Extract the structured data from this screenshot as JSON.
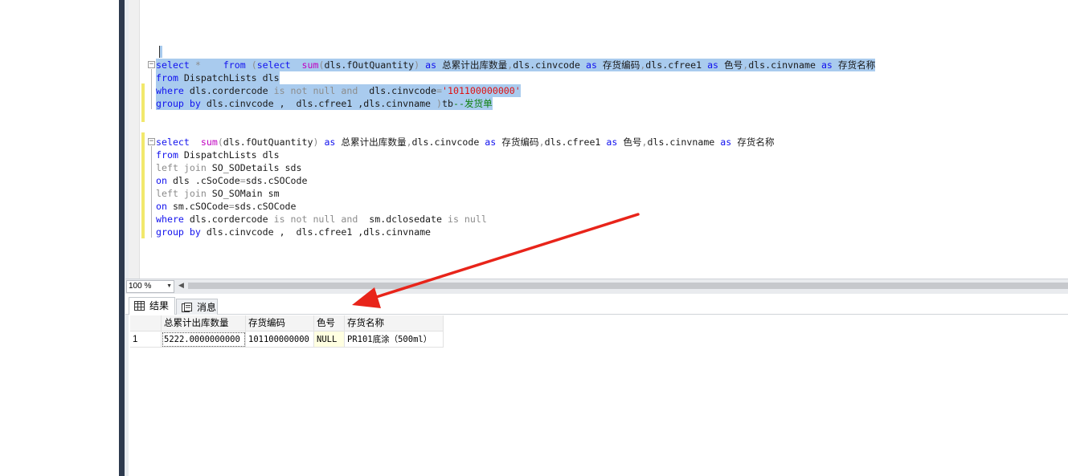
{
  "editor": {
    "query1": {
      "line1": [
        {
          "t": "select",
          "c": "kw"
        },
        {
          "t": " * ",
          "c": "gr"
        },
        {
          "t": "   ",
          "c": ""
        },
        {
          "t": "from",
          "c": "kw"
        },
        {
          "t": " (",
          "c": "gr"
        },
        {
          "t": "select",
          "c": "kw"
        },
        {
          "t": "  ",
          "c": ""
        },
        {
          "t": "sum",
          "c": "fn"
        },
        {
          "t": "(",
          "c": "gr"
        },
        {
          "t": "dls.fOutQuantity",
          "c": ""
        },
        {
          "t": ")",
          "c": "gr"
        },
        {
          "t": " ",
          "c": ""
        },
        {
          "t": "as",
          "c": "kw"
        },
        {
          "t": " 总累计出库数量",
          "c": ""
        },
        {
          "t": ",",
          "c": "gr"
        },
        {
          "t": "dls.cinvcode ",
          "c": ""
        },
        {
          "t": "as",
          "c": "kw"
        },
        {
          "t": " 存货编码",
          "c": ""
        },
        {
          "t": ",",
          "c": "gr"
        },
        {
          "t": "dls.cfree1 ",
          "c": ""
        },
        {
          "t": "as",
          "c": "kw"
        },
        {
          "t": " 色号",
          "c": ""
        },
        {
          "t": ",",
          "c": "gr"
        },
        {
          "t": "dls.cinvname ",
          "c": ""
        },
        {
          "t": "as",
          "c": "kw"
        },
        {
          "t": " 存货名称",
          "c": ""
        }
      ],
      "line2": [
        {
          "t": "from",
          "c": "kw"
        },
        {
          "t": " DispatchLists dls",
          "c": ""
        }
      ],
      "line3": [
        {
          "t": "where",
          "c": "kw"
        },
        {
          "t": " dls.cordercode ",
          "c": ""
        },
        {
          "t": "is not null and",
          "c": "gr"
        },
        {
          "t": "  dls.cinvcode",
          "c": ""
        },
        {
          "t": "=",
          "c": "gr"
        },
        {
          "t": "'101100000000'",
          "c": "str"
        }
      ],
      "line4": [
        {
          "t": "group by",
          "c": "kw"
        },
        {
          "t": " dls.cinvcode , ",
          "c": ""
        },
        {
          "t": " dls.cfree1 ,dls.cinvname ",
          "c": ""
        },
        {
          "t": ")",
          "c": "gr"
        },
        {
          "t": "tb",
          "c": ""
        },
        {
          "t": "--发货单",
          "c": "cm"
        }
      ]
    },
    "query2": [
      [
        {
          "t": "select",
          "c": "kw"
        },
        {
          "t": "  ",
          "c": ""
        },
        {
          "t": "sum",
          "c": "fn"
        },
        {
          "t": "(",
          "c": "gr"
        },
        {
          "t": "dls.fOutQuantity",
          "c": ""
        },
        {
          "t": ")",
          "c": "gr"
        },
        {
          "t": " ",
          "c": ""
        },
        {
          "t": "as",
          "c": "kw"
        },
        {
          "t": " 总累计出库数量",
          "c": ""
        },
        {
          "t": ",",
          "c": "gr"
        },
        {
          "t": "dls.cinvcode ",
          "c": ""
        },
        {
          "t": "as",
          "c": "kw"
        },
        {
          "t": " 存货编码",
          "c": ""
        },
        {
          "t": ",",
          "c": "gr"
        },
        {
          "t": "dls.cfree1 ",
          "c": ""
        },
        {
          "t": "as",
          "c": "kw"
        },
        {
          "t": " 色号",
          "c": ""
        },
        {
          "t": ",",
          "c": "gr"
        },
        {
          "t": "dls.cinvname ",
          "c": ""
        },
        {
          "t": "as",
          "c": "kw"
        },
        {
          "t": " 存货名称",
          "c": ""
        }
      ],
      [
        {
          "t": "from",
          "c": "kw"
        },
        {
          "t": " DispatchLists dls",
          "c": ""
        }
      ],
      [
        {
          "t": "left join",
          "c": "gr"
        },
        {
          "t": " SO_SODetails sds",
          "c": ""
        }
      ],
      [
        {
          "t": "on",
          "c": "kw"
        },
        {
          "t": " dls .cSoCode",
          "c": ""
        },
        {
          "t": "=",
          "c": "gr"
        },
        {
          "t": "sds.cSOCode",
          "c": ""
        }
      ],
      [
        {
          "t": "left join",
          "c": "gr"
        },
        {
          "t": " SO_SOMain sm",
          "c": ""
        }
      ],
      [
        {
          "t": "on",
          "c": "kw"
        },
        {
          "t": " sm.cSOCode",
          "c": ""
        },
        {
          "t": "=",
          "c": "gr"
        },
        {
          "t": "sds.cSOCode",
          "c": ""
        }
      ],
      [
        {
          "t": "where",
          "c": "kw"
        },
        {
          "t": " dls.cordercode ",
          "c": ""
        },
        {
          "t": "is not null and",
          "c": "gr"
        },
        {
          "t": "  sm.dclosedate ",
          "c": ""
        },
        {
          "t": "is null",
          "c": "gr"
        }
      ],
      [
        {
          "t": "group by",
          "c": "kw"
        },
        {
          "t": " dls.cinvcode , ",
          "c": ""
        },
        {
          "t": " dls.cfree1 ,dls.cinvname",
          "c": ""
        }
      ]
    ]
  },
  "toolbar": {
    "zoom": "100 %"
  },
  "tabs": {
    "results": "结果",
    "messages": "消息"
  },
  "grid": {
    "columns": [
      "总累计出库数量",
      "存货编码",
      "色号",
      "存货名称"
    ],
    "rows": [
      {
        "num": "1",
        "cells": [
          "5222.0000000000",
          "101100000000",
          "NULL",
          "PR101底涂（500ml）"
        ]
      }
    ]
  },
  "colors": {
    "selection": "#a9cbee",
    "keyword": "#1212ee",
    "function": "#c000c0",
    "string": "#e01010",
    "comment": "#108010",
    "arrow": "#e8241a"
  }
}
